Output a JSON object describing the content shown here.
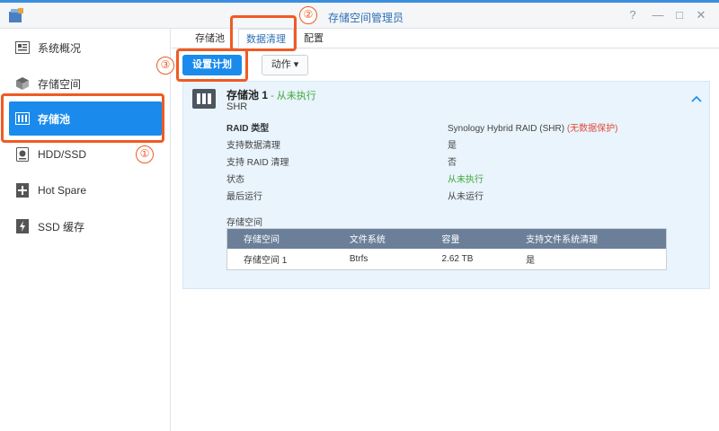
{
  "window": {
    "title": "存储空间管理员",
    "buttons": [
      "?",
      "—",
      "□",
      "✕"
    ]
  },
  "sidebar": {
    "items": [
      {
        "label": "系统概况",
        "icon": "overview-icon"
      },
      {
        "label": "存储空间",
        "icon": "volume-icon"
      },
      {
        "label": "存储池",
        "icon": "storage-pool-icon",
        "active": true
      },
      {
        "label": "HDD/SSD",
        "icon": "hdd-icon"
      },
      {
        "label": "Hot Spare",
        "icon": "hot-spare-icon"
      },
      {
        "label": "SSD 缓存",
        "icon": "ssd-cache-icon"
      }
    ]
  },
  "tabs": [
    {
      "label": "存储池"
    },
    {
      "label": "数据清理",
      "active": true
    },
    {
      "label": "配置"
    }
  ],
  "toolbar": {
    "schedule_label": "设置计划",
    "action_label": "动作 ▾"
  },
  "pool": {
    "name": "存储池 1",
    "status": " - 从未执行",
    "type": "SHR",
    "details": [
      {
        "key": "RAID 类型",
        "value": "Synology Hybrid RAID (SHR) ",
        "warn": "(无数据保护)"
      },
      {
        "key": "支持数据清理",
        "value": "是"
      },
      {
        "key": "支持 RAID 清理",
        "value": "否"
      },
      {
        "key": "状态",
        "value": "从未执行"
      },
      {
        "key": "最后运行",
        "value": "从未运行"
      }
    ],
    "volumes_label": "存储空间",
    "table": {
      "headers": [
        "存储空间",
        "文件系统",
        "容量",
        "支持文件系统清理"
      ],
      "rows": [
        [
          "存储空间 1",
          "Btrfs",
          "2.62 TB",
          "是"
        ]
      ]
    }
  },
  "annotations": [
    "①",
    "②",
    "③"
  ],
  "colors": {
    "accent": "#1a8bec",
    "highlight": "#f05a24",
    "success": "#3ea83a",
    "warning": "#e04a3a"
  }
}
